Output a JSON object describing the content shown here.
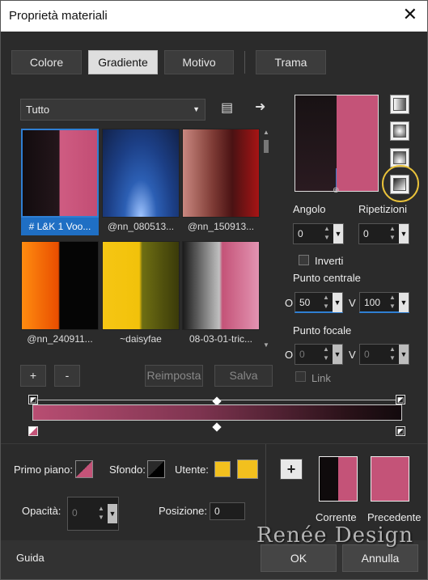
{
  "window": {
    "title": "Proprietà materiali",
    "close": "✕"
  },
  "tabs": [
    {
      "label": "Colore"
    },
    {
      "label": "Gradiente"
    },
    {
      "label": "Motivo"
    },
    {
      "label": "Trama"
    }
  ],
  "filter": {
    "value": "Tutto"
  },
  "gradients": [
    {
      "label": "# L&K 1 Voo...",
      "bg": "linear-gradient(90deg,#120c0e 0%,#24161b 49%,#cf5c82 50%,#c24d74 100%)"
    },
    {
      "label": "@nn_080513...",
      "bg": "radial-gradient(ellipse at 50% 100%,#9fc4ff 0%,#2c5fb4 30%,#1c3f86 60%,#12224a 100%)"
    },
    {
      "label": "@nn_150913...",
      "bg": "linear-gradient(90deg,#c98880 0%,#7d3a34 40%,#4a1213 65%,#a71414 100%)"
    },
    {
      "label": "@nn_240911...",
      "bg": "linear-gradient(90deg,#ff8c10 0%,#e94e00 48%,#050505 50%,#050505 100%)"
    },
    {
      "label": "~daisyfae",
      "bg": "linear-gradient(90deg,#f6c614 0%,#f2c20a 48%,#6e6e12 52%,#3a3a0a 100%)"
    },
    {
      "label": "08-03-01-tric...",
      "bg": "linear-gradient(90deg,#1a1a1a 0%,#c0c0c0 48%,#c45378 52%,#e394b2 100%)"
    }
  ],
  "buttons": {
    "add": "+",
    "remove": "-",
    "reset": "Reimposta",
    "save": "Salva"
  },
  "controls": {
    "angle_label": "Angolo",
    "angle": "0",
    "repeat_label": "Ripetizioni",
    "repeat": "0",
    "invert": "Inverti",
    "center_label": "Punto centrale",
    "center_h_axis": "O",
    "center_h": "50",
    "center_v_axis": "V",
    "center_v": "100",
    "focal_label": "Punto focale",
    "focal_h_axis": "O",
    "focal_h": "0",
    "focal_v_axis": "V",
    "focal_v": "0",
    "link": "Link"
  },
  "bottom": {
    "foreground_label": "Primo piano:",
    "background_label": "Sfondo:",
    "user_label": "Utente:",
    "opacity_label": "Opacità:",
    "opacity": "0",
    "position_label": "Posizione:",
    "position": "0",
    "current_label": "Corrente",
    "previous_label": "Precedente",
    "user_color": "#f2c01e",
    "previous_color": "#c45378"
  },
  "footer": {
    "help": "Guida",
    "ok": "OK",
    "cancel": "Annulla"
  },
  "watermark": "Renée Design"
}
